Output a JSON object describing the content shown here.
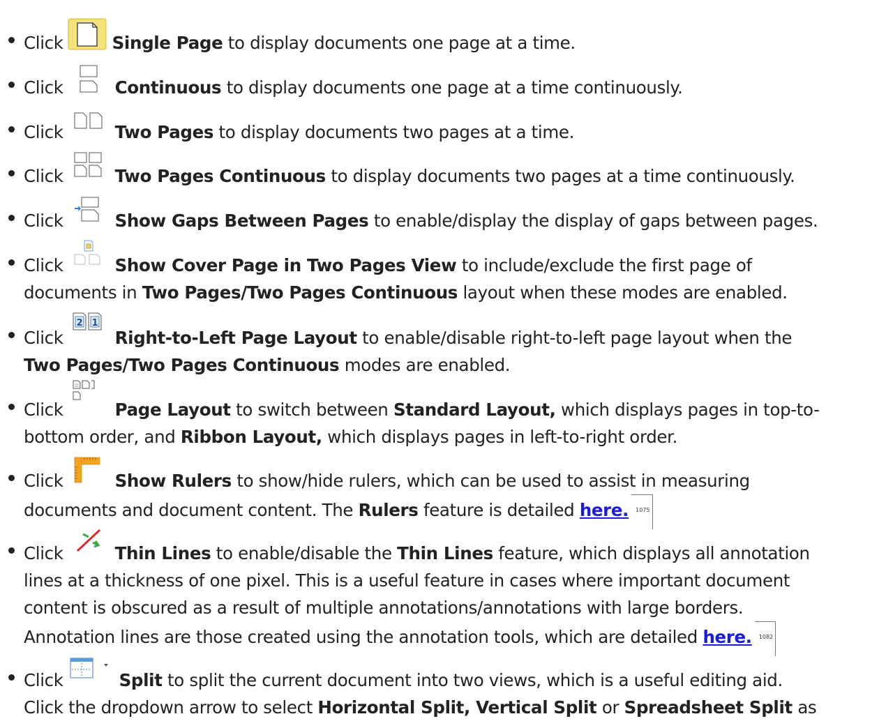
{
  "items": [
    {
      "click": "Click",
      "icon": "single-page-icon",
      "label": "Single Page",
      "text": "to display documents one page at a time."
    },
    {
      "click": "Click",
      "icon": "continuous-icon",
      "label": "Continuous",
      "text": "to display documents one page at a time continuously."
    },
    {
      "click": "Click",
      "icon": "two-pages-icon",
      "label": "Two Pages",
      "text": "to display documents two pages at a time."
    },
    {
      "click": "Click",
      "icon": "two-pages-continuous-icon",
      "label": "Two Pages Continuous",
      "text": "to display documents two pages at a time continuously."
    },
    {
      "click": "Click",
      "icon": "show-gaps-icon",
      "label": "Show Gaps Between Pages",
      "text": "to enable/display the display of gaps between pages."
    },
    {
      "click": "Click",
      "icon": "cover-page-icon",
      "label": "Show Cover Page in Two Pages View",
      "text": "to include/exclude the first page of",
      "cont1a": "documents in",
      "cont1b": "Two Pages/Two Pages Continuous",
      "cont1c": "layout when these modes are enabled."
    },
    {
      "click": "Click",
      "icon": "right-to-left-icon",
      "label": "Right-to-Left Page Layout",
      "text": "to enable/disable right-to-left page layout when the",
      "cont1a": "Two Pages/Two Pages Continuous",
      "cont1b": "modes are enabled."
    },
    {
      "click": "Click",
      "icon": "page-layout-icon",
      "label": "Page Layout",
      "text": "to switch between",
      "bold2": "Standard Layout,",
      "text2": "which displays pages in top-to-",
      "cont1a": "bottom order, and",
      "cont1b": "Ribbon Layout,",
      "cont1c": "which displays pages in left-to-right order."
    },
    {
      "click": "Click",
      "icon": "rulers-icon",
      "label": "Show Rulers",
      "text": "to show/hide rulers, which can be used to assist in measuring",
      "cont1a": "documents and document content. The",
      "cont1b": "Rulers",
      "cont1c": "feature is detailed",
      "link": "here.",
      "ref": "1075"
    },
    {
      "click": "Click",
      "icon": "thin-lines-icon",
      "label": "Thin Lines",
      "text": "to enable/disable the",
      "bold2": "Thin Lines",
      "text2": "feature, which displays all annotation",
      "cont1": "lines at a thickness of one pixel. This is a useful feature in cases where important document",
      "cont2": "content is obscured as a result of multiple annotations/annotations with large borders.",
      "cont3": "Annotation lines are those created using the annotation tools, which are detailed",
      "link": "here.",
      "ref": "1082"
    },
    {
      "click": "Click",
      "icon": "split-icon",
      "label": "Split",
      "text": "to split the current document into two views, which is a useful editing aid.",
      "cont1a": "Click the dropdown arrow to select",
      "cont1b": "Horizontal Split, Vertical Split",
      "cont1c": "or",
      "cont1d": "Spreadsheet Split",
      "cont1e": "as"
    }
  ]
}
